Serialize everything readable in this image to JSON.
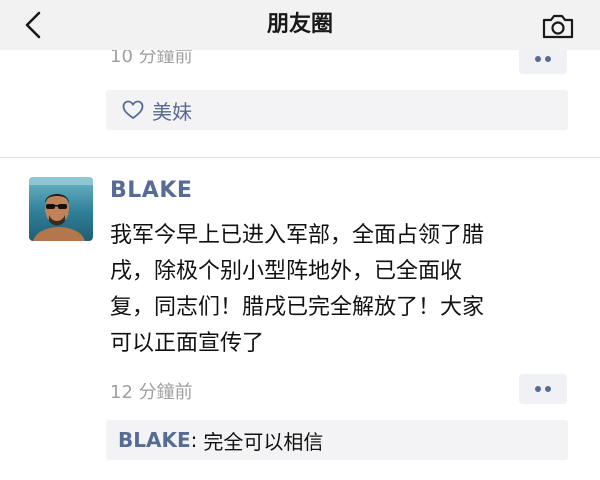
{
  "colors": {
    "link": "#576b95",
    "text": "#111111",
    "muted": "#a0a0a0",
    "nav_bg": "#f2f2f2",
    "box_bg": "#f3f3f5"
  },
  "navbar": {
    "title": "朋友圈",
    "back_icon": "chevron-left-icon",
    "camera_icon": "camera-icon"
  },
  "previous_post": {
    "time": "10 分鐘前",
    "more_icon": "more-dots-icon",
    "likes_icon": "heart-outline-icon",
    "likes": [
      "美妹"
    ]
  },
  "post": {
    "author": "BLAKE",
    "avatar_icon": "avatar-photo",
    "content_lines": [
      "我军今早上已进入军部，全面占领了腊",
      "戌，除极个别小型阵地外，已全面收",
      "复，同志们！腊戌已完全解放了！大家",
      "可以正面宣传了"
    ],
    "time": "12 分鐘前",
    "more_icon": "more-dots-icon",
    "comments": [
      {
        "author": "BLAKE",
        "separator": ":",
        "text": "完全可以相信"
      }
    ]
  }
}
